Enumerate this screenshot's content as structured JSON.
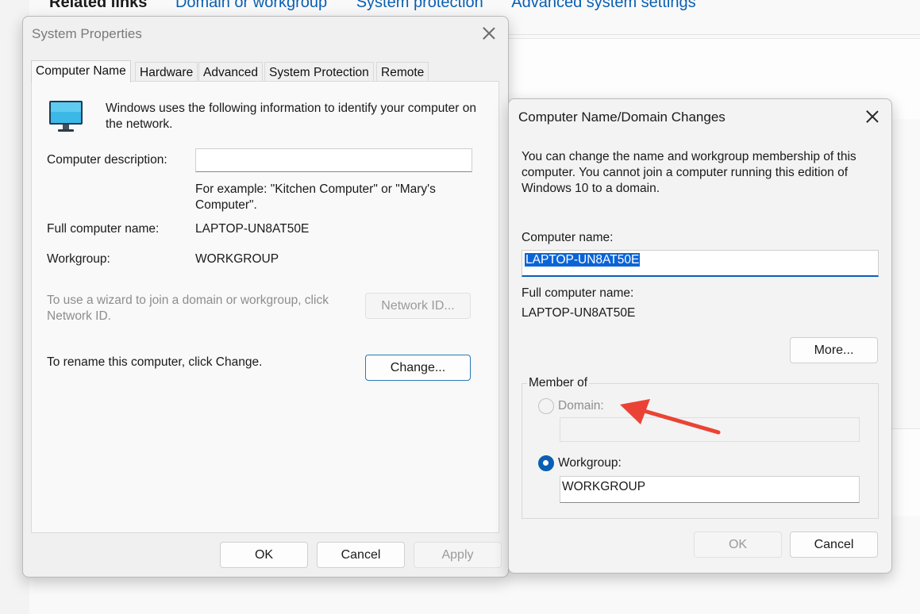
{
  "background": {
    "related_links": "Related links",
    "links": [
      "Domain or workgroup",
      "System protection",
      "Advanced system settings"
    ]
  },
  "system_properties": {
    "title": "System Properties",
    "tabs": [
      {
        "label": "Computer Name",
        "active": true
      },
      {
        "label": "Hardware",
        "active": false
      },
      {
        "label": "Advanced",
        "active": false
      },
      {
        "label": "System Protection",
        "active": false
      },
      {
        "label": "Remote",
        "active": false
      }
    ],
    "intro": "Windows uses the following information to identify your computer on the network.",
    "computer_description_label": "Computer description:",
    "computer_description_value": "",
    "example_text": "For example: \"Kitchen Computer\" or \"Mary's Computer\".",
    "full_name_label": "Full computer name:",
    "full_name_value": "LAPTOP-UN8AT50E",
    "workgroup_label": "Workgroup:",
    "workgroup_value": "WORKGROUP",
    "wizard_text": "To use a wizard to join a domain or workgroup, click Network ID.",
    "network_id_button": "Network ID...",
    "rename_text": "To rename this computer, click Change.",
    "change_button": "Change...",
    "ok_button": "OK",
    "cancel_button": "Cancel",
    "apply_button": "Apply"
  },
  "name_changes": {
    "title": "Computer Name/Domain Changes",
    "description": "You can change the name and workgroup membership of this computer. You cannot join a computer running this edition of Windows 10 to a domain.",
    "computer_name_label": "Computer name:",
    "computer_name_value": "LAPTOP-UN8AT50E",
    "full_name_label": "Full computer name:",
    "full_name_value": "LAPTOP-UN8AT50E",
    "more_button": "More...",
    "member_of_label": "Member of",
    "domain_label": "Domain:",
    "domain_value": "",
    "workgroup_label": "Workgroup:",
    "workgroup_value": "WORKGROUP",
    "ok_button": "OK",
    "cancel_button": "Cancel"
  },
  "colors": {
    "accent": "#0a5fb4",
    "link": "#0a5fb4",
    "annotation_arrow": "#ea4335"
  },
  "icons": {
    "computer": "monitor-icon",
    "close": "close-icon",
    "annotation": "red-arrow-annotation"
  }
}
